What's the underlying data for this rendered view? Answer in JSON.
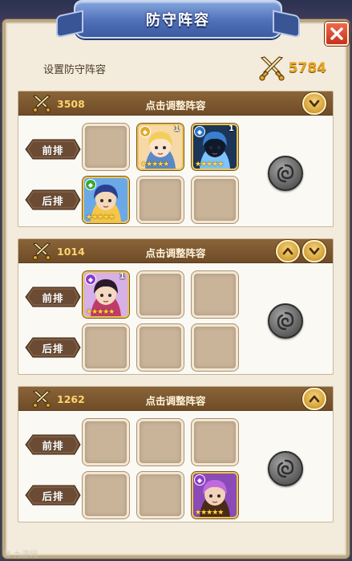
{
  "window": {
    "title": "防守阵容",
    "close_label": "X"
  },
  "summary": {
    "label": "设置防守阵容",
    "total_power": "5784",
    "icon": "crossed-swords-icon"
  },
  "row_labels": {
    "front": "前排",
    "back": "后排"
  },
  "formations": [
    {
      "power": "3508",
      "adjust_label": "点击调整阵容",
      "arrows": [
        "down"
      ],
      "front": [
        {
          "type": "empty"
        },
        {
          "type": "hero",
          "portrait": "blonde-maid-hero",
          "level": "1",
          "stars": "★★★★★",
          "badge_color": "#e0a92a",
          "frame": "#e8c35a"
        },
        {
          "type": "hero",
          "portrait": "dark-armored-dragon-hero",
          "level": "1",
          "stars": "★★★★★",
          "badge_color": "#2d74c8",
          "frame": "#e8c35a"
        }
      ],
      "back": [
        {
          "type": "hero",
          "portrait": "blue-hat-mage-hero",
          "level": "",
          "stars": "★★★★★",
          "badge_color": "#38a83a",
          "frame": "#e8c35a"
        },
        {
          "type": "empty"
        },
        {
          "type": "empty"
        }
      ]
    },
    {
      "power": "1014",
      "adjust_label": "点击调整阵容",
      "arrows": [
        "up",
        "down"
      ],
      "front": [
        {
          "type": "hero",
          "portrait": "dark-haired-girl-hero",
          "level": "1",
          "stars": "★★★★★",
          "badge_color": "#8b3cc8",
          "frame": "#e8c35a"
        },
        {
          "type": "empty"
        },
        {
          "type": "empty"
        }
      ],
      "back": [
        {
          "type": "empty"
        },
        {
          "type": "empty"
        },
        {
          "type": "empty"
        }
      ]
    },
    {
      "power": "1262",
      "adjust_label": "点击调整阵容",
      "arrows": [
        "up"
      ],
      "front": [
        {
          "type": "empty"
        },
        {
          "type": "empty"
        },
        {
          "type": "empty"
        }
      ],
      "back": [
        {
          "type": "empty"
        },
        {
          "type": "empty"
        },
        {
          "type": "hero",
          "portrait": "purple-hair-warrior-hero",
          "level": "",
          "stars": "★★★★★",
          "badge_color": "#8b3cc8",
          "frame": "#e8c35a"
        }
      ]
    }
  ]
}
